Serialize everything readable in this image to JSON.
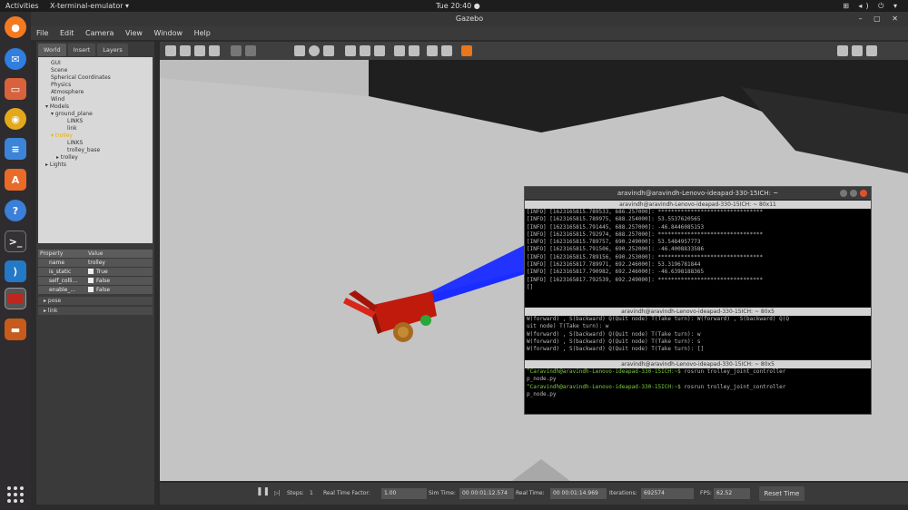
{
  "topbar": {
    "activities": "Activities",
    "app_menu": "X-terminal-emulator ▾",
    "clock": "Tue 20:40 ●",
    "tray": "⊞ ◂) ⏻ ▾"
  },
  "dock": {
    "icons": [
      "firefox-icon",
      "thunderbird-icon",
      "files-icon",
      "rhythmbox-icon",
      "libreoffice-writer-icon",
      "software-center-icon",
      "help-icon",
      "terminal-icon",
      "vscode-icon",
      "gazebo-icon",
      "books-icon",
      "show-apps-icon"
    ]
  },
  "window": {
    "title": "Gazebo",
    "controls": "– ▢ ✕"
  },
  "menu": {
    "items": [
      "File",
      "Edit",
      "Camera",
      "View",
      "Window",
      "Help"
    ]
  },
  "left_panel": {
    "tabs": [
      "World",
      "Insert",
      "Layers"
    ],
    "tree": [
      "GUI",
      "Scene",
      "Spherical Coordinates",
      "Physics",
      "Atmosphere",
      "Wind",
      "▾ Models",
      "▾ ground_plane",
      "LINKS",
      "link",
      "▾ trolley",
      "LINKS",
      "trolley_base",
      "▸ trolley",
      "▸ Lights"
    ],
    "props_header_property": "Property",
    "props_header_value": "Value",
    "rows": [
      {
        "k": "name",
        "v": "trolley"
      },
      {
        "k": "is_static",
        "v": "True"
      },
      {
        "k": "self_colli...",
        "v": "False"
      },
      {
        "k": "enable_...",
        "v": "False"
      }
    ],
    "groups": [
      "▸ pose",
      "▸ link"
    ]
  },
  "bottom": {
    "pause": "❚❚",
    "steps_label": "Steps:",
    "steps_value": "1",
    "rtf_label": "Real Time Factor:",
    "rtf_value": "1.00",
    "sim_label": "Sim Time:",
    "sim_value": "00 00:01:12.574",
    "real_label": "Real Time:",
    "real_value": "00 00:01:14.969",
    "iter_label": "Iterations:",
    "iter_value": "692574",
    "fps_label": "FPS:",
    "fps_value": "62.52",
    "reset": "Reset Time"
  },
  "terminal": {
    "title": "aravindh@aravindh-Lenovo-ideapad-330-15ICH: ~",
    "pane1_title": "aravindh@aravindh-Lenovo-ideapad-330-15ICH: ~ 80x11",
    "pane1_lines": [
      "[INFO] [1623165815.789533, 686.257000]: ********************************",
      "[INFO] [1623165815.789975, 688.254000]: 53.5537620565",
      "[INFO] [1623165815.791445, 688.257000]: -46.8446085153",
      "[INFO] [1623165815.792974, 688.257000]: ********************************",
      "[INFO] [1623165815.789757, 690.249000]: 53.5484957773",
      "[INFO] [1623165815.791506, 690.252000]: -46.4008833586",
      "[INFO] [1623165815.789156, 690.253000]: ********************************",
      "[INFO] [1623165817.789971, 692.246000]: 53.3196781844",
      "[INFO] [1623165817.790982, 692.246000]: -46.6398188365",
      "[INFO] [1623165817.792539, 692.249000]: ********************************",
      "[]"
    ],
    "pane2_title": "aravindh@aravindh-Lenovo-ideapad-330-15ICH: ~ 80x5",
    "pane2_lines": [
      "W(forward) , S(backward) Q(Quit node) T(Take turn): W(forward) , S(backward) Q(Q",
      "uit node) T(Take turn): w",
      "W(forward) , S(backward) Q(Quit node) T(Take turn): w",
      "W(forward) , S(backward) Q(Quit node) T(Take turn): s",
      "W(forward) , S(backward) Q(Quit node) T(Take turn): []"
    ],
    "pane3_title": "aravindh@aravindh-Lenovo-ideapad-330-15ICH: ~ 80x5",
    "pane3_prompt1": "^Caravindh@aravindh-Lenovo-ideapad-330-15ICH:~$",
    "pane3_cmd1": " rosrun trolley_joint_controller",
    "pane3_cont1": "p_node.py",
    "pane3_prompt2": "^Caravindh@aravindh-Lenovo-ideapad-330-15ICH:~$",
    "pane3_cmd2": " rosrun trolley_joint_controller",
    "pane3_cont2": "p_node.py"
  },
  "colors": {
    "accent": "#e95420",
    "trolley": "#cc1f10",
    "laser": "#1a2cff",
    "prompt": "#7cd13a"
  }
}
